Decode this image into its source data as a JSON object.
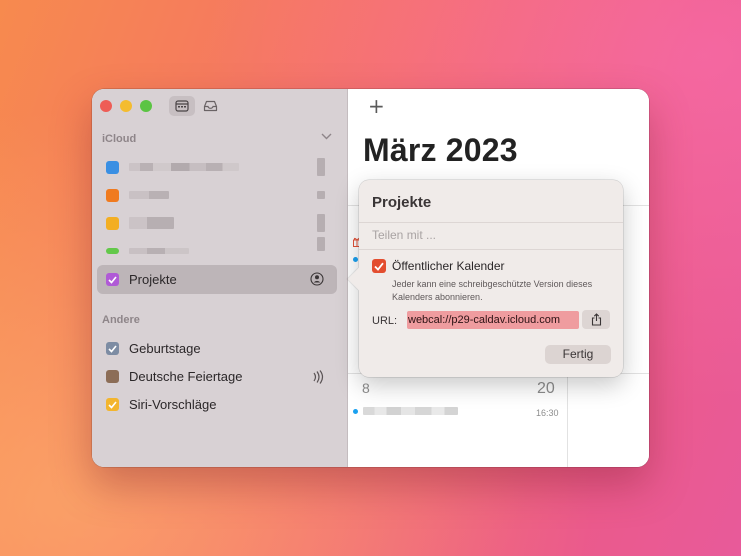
{
  "sidebar": {
    "icloud_label": "iCloud",
    "other_label": "Andere",
    "icloud_calendars": [
      {
        "label": "Projekte",
        "color": "#b05ad6"
      }
    ],
    "other_calendars": [
      {
        "label": "Geburtstage",
        "color": "#7d8ca3"
      },
      {
        "label": "Deutsche Feiertage",
        "color": "#8c6d57"
      },
      {
        "label": "Siri-Vorschläge",
        "color": "#f3b52e"
      }
    ],
    "toolbar_icons": [
      "calendar-list-icon",
      "inbox-icon"
    ]
  },
  "main": {
    "add_label": "+",
    "month_title": "März 2023",
    "day_numbers": [
      "8",
      "20"
    ],
    "event_time": "16:30"
  },
  "popover": {
    "title": "Projekte",
    "share_placeholder": "Teilen mit ...",
    "public_calendar_label": "Öffentlicher Kalender",
    "public_calendar_checked": true,
    "public_calendar_description": "Jeder kann eine schreibgeschützte Version dieses Kalenders abonnieren.",
    "url_label": "URL:",
    "url_value": "webcal://p29-caldav.icloud.com",
    "done_label": "Fertig"
  },
  "colors": {
    "accent_check": "#e34d2f",
    "url_highlight": "#ef9c9f",
    "event_dot": "#1aa1f0"
  }
}
